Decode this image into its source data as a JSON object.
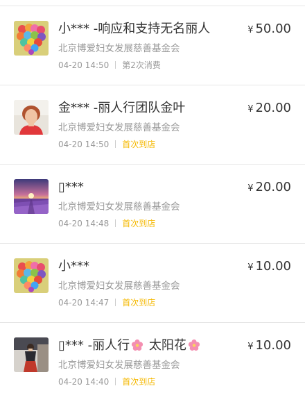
{
  "currency_symbol": "¥",
  "colors": {
    "first_visit_tag": "#f5b800",
    "muted_text": "#999999",
    "primary_text": "#333333",
    "divider": "#e6e6e6"
  },
  "records": [
    {
      "avatar_icon": "balloon-heart-icon",
      "name": "小***",
      "message": "-响应和支持无名丽人",
      "organization": "北京博爱妇女发展慈善基金会",
      "time": "04-20 14:50",
      "tag": "第2次消费",
      "amount": "50.00"
    },
    {
      "avatar_icon": "portrait-woman-icon",
      "name": "金***",
      "message": "-丽人行团队金叶",
      "organization": "北京博爱妇女发展慈善基金会",
      "time": "04-20 14:50",
      "tag": "首次到店",
      "amount": "20.00"
    },
    {
      "avatar_icon": "lavender-field-icon",
      "name": "▯***",
      "message": "",
      "organization": "北京博爱妇女发展慈善基金会",
      "time": "04-20 14:48",
      "tag": "首次到店",
      "amount": "20.00"
    },
    {
      "avatar_icon": "balloon-heart-icon",
      "name": "小***",
      "message": "",
      "organization": "北京博爱妇女发展慈善基金会",
      "time": "04-20 14:47",
      "tag": "首次到店",
      "amount": "10.00"
    },
    {
      "avatar_icon": "portrait-standing-woman-icon",
      "name": "▯***",
      "message": "-丽人行",
      "message_suffix": "太阳花",
      "organization": "北京博爱妇女发展慈善基金会",
      "time": "04-20 14:40",
      "tag": "首次到店",
      "amount": "10.00"
    }
  ]
}
